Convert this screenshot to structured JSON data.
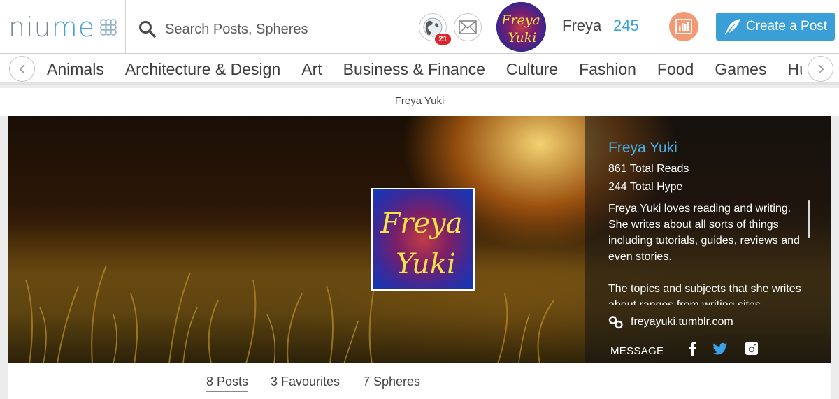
{
  "header": {
    "logo_text_a": "niu",
    "logo_text_b": "me",
    "search_placeholder": "Search Posts, Spheres",
    "notification_count": "21",
    "user_name": "Freya",
    "user_points": "245",
    "create_label": "Create a Post",
    "avatar_text_line1": "Freya",
    "avatar_text_line2": "Yuki"
  },
  "categories": [
    "Animals",
    "Architecture & Design",
    "Art",
    "Business & Finance",
    "Culture",
    "Fashion",
    "Food",
    "Games",
    "Hu"
  ],
  "page": {
    "title": "Freya Yuki"
  },
  "profile": {
    "pic_line1": "Freya",
    "pic_line2": "Yuki",
    "name": "Freya Yuki",
    "total_reads": "861 Total Reads",
    "total_hype": "244 Total Hype",
    "bio_p1": "Freya Yuki loves reading and writing. She writes about all sorts of things including tutorials, guides, reviews and even stories.",
    "bio_p2": "The topics and subjects that she writes about ranges from writing sites",
    "link": "freyayuki.tumblr.com",
    "message_label": "MESSAGE"
  },
  "tabs": {
    "posts": "8 Posts",
    "favourites": "3 Favourites",
    "spheres": "7 Spheres"
  },
  "colors": {
    "accent_blue": "#3a9fd6",
    "badge_red": "#d9262d",
    "stats_orange": "#f39a74"
  }
}
